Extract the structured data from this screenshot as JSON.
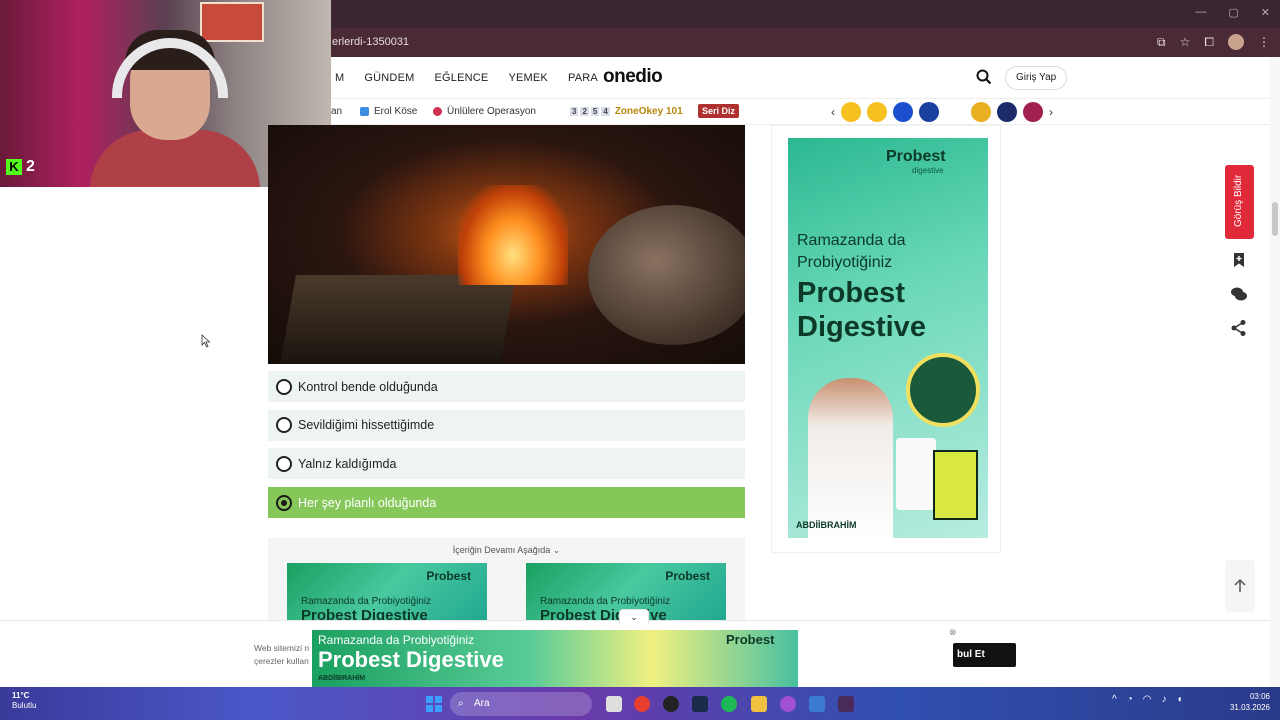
{
  "browser": {
    "url": "erlerdi-1350031"
  },
  "header": {
    "nav": [
      "M",
      "GÜNDEM",
      "EĞLENCE",
      "YEMEK",
      "PARA"
    ],
    "logo": "onedio",
    "login_label": "Giriş Yap"
  },
  "trends": {
    "item1": "an",
    "item2": "Erol Köse",
    "item3": "Ünlülere Operasyon",
    "numbers": [
      "3",
      "2",
      "5",
      "4"
    ],
    "zone": "ZoneOkey 101",
    "seri": "Seri Diz"
  },
  "webcam": {
    "kick_count": "2"
  },
  "quiz": {
    "options": [
      {
        "label": "Kontrol bende olduğunda",
        "selected": false
      },
      {
        "label": "Sevildiğimi hissettiğimde",
        "selected": false
      },
      {
        "label": "Yalnız kaldığımda",
        "selected": false
      },
      {
        "label": "Her şey planlı olduğunda",
        "selected": true
      }
    ],
    "more_label": "İçeriğin Devamı Aşağıda"
  },
  "ads": {
    "brand": "Probest",
    "brand_sub": "digestive",
    "line1": "Ramazanda da Probiyotiğiniz",
    "line2": "Probest Digestive",
    "abdi": "ABDİİBRAHİM",
    "mini_line1": "Ramazanda da Probiyotiğiniz",
    "mini_line2": "Probest Digestive",
    "bottom_line1": "Ramazanda da Probiyotiğiniz",
    "bottom_line2": "Probest Digestive",
    "bottom_abdi": "ABDİİBRAHİM"
  },
  "sidebar": {
    "feedback": "Görüş Bildir"
  },
  "cookie": {
    "text_line1": "Web sitemizi n",
    "text_line2": "çerezler kullan",
    "accept": "bul Et"
  },
  "taskbar": {
    "temp": "11°C",
    "weather": "Bulutlu",
    "search": "Ara",
    "time": "03:06",
    "date": "31.03.2026"
  },
  "colors": {
    "selected_option": "#86c75a",
    "feedback": "#e02a3a",
    "option_bg": "#eef5f0"
  }
}
